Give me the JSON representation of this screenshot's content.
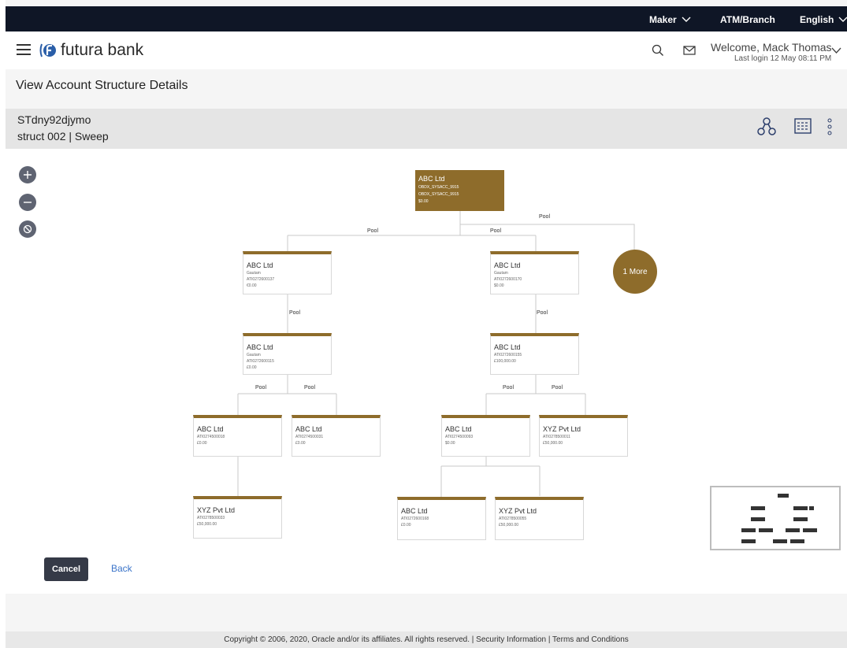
{
  "topbar": {
    "role": "Maker",
    "location": "ATM/Branch",
    "language": "English"
  },
  "header": {
    "brand": "futura bank",
    "welcome": "Welcome, Mack Thomas",
    "last_login": "Last login 12 May 08:11 PM",
    "icons": [
      "menu-icon",
      "search-icon",
      "mail-icon",
      "chevron-down-icon"
    ]
  },
  "page": {
    "title": "View Account Structure Details"
  },
  "summary": {
    "structure_id": "STdny92djymo",
    "structure_desc": "struct 002  |  Sweep",
    "icons": [
      "tree-view-icon",
      "table-view-icon",
      "more-options-icon"
    ]
  },
  "tree": {
    "root": {
      "name": "ABC Ltd",
      "line1": "OBDX_SYSACC_9915",
      "line2": "OBDX_SYSACC_9915",
      "line3": "$0.00"
    },
    "nodes": {
      "n1": {
        "name": "ABC Ltd",
        "line1": "Gautam",
        "line2": "ATI0272600137",
        "line3": "€0.00"
      },
      "n2": {
        "name": "ABC Ltd",
        "line1": "Gautam",
        "line2": "ATI0272600170",
        "line3": "$0.00"
      },
      "n3": {
        "name": "ABC Ltd",
        "line1": "Gautam",
        "line2": "ATI0272600115",
        "line3": "£0.00"
      },
      "n4": {
        "name": "ABC Ltd",
        "line1": "ATI0272600155",
        "line2": "£100,000.00",
        "line3": ""
      },
      "n5": {
        "name": "ABC Ltd",
        "line1": "ATI0274500018",
        "line2": "£0.00",
        "line3": ""
      },
      "n6": {
        "name": "ABC Ltd",
        "line1": "ATI0274500031",
        "line2": "£0.00",
        "line3": ""
      },
      "n7": {
        "name": "ABC Ltd",
        "line1": "ATI0274500093",
        "line2": "$0.00",
        "line3": ""
      },
      "n8": {
        "name": "XYZ Pvt Ltd",
        "line1": "ATI0278500011",
        "line2": "£50,000.00",
        "line3": ""
      },
      "n9": {
        "name": "XYZ Pvt Ltd",
        "line1": "ATI0278500033",
        "line2": "£50,000.00",
        "line3": ""
      },
      "n10": {
        "name": "ABC Ltd",
        "line1": "ATI0272600168",
        "line2": "£0.00",
        "line3": ""
      },
      "n11": {
        "name": "XYZ Pvt Ltd",
        "line1": "ATI0278500055",
        "line2": "£50,000.00",
        "line3": ""
      }
    },
    "more_label": "1 More",
    "link_label": "Pool",
    "accent_color": "#8e6c2b"
  },
  "zoom_controls": [
    "zoom-in-icon",
    "zoom-out-icon",
    "reset-icon"
  ],
  "actions": {
    "cancel": "Cancel",
    "back": "Back"
  },
  "footer": {
    "text": "Copyright © 2006, 2020, Oracle and/or its affiliates. All rights reserved. | Security Information | Terms and Conditions"
  }
}
